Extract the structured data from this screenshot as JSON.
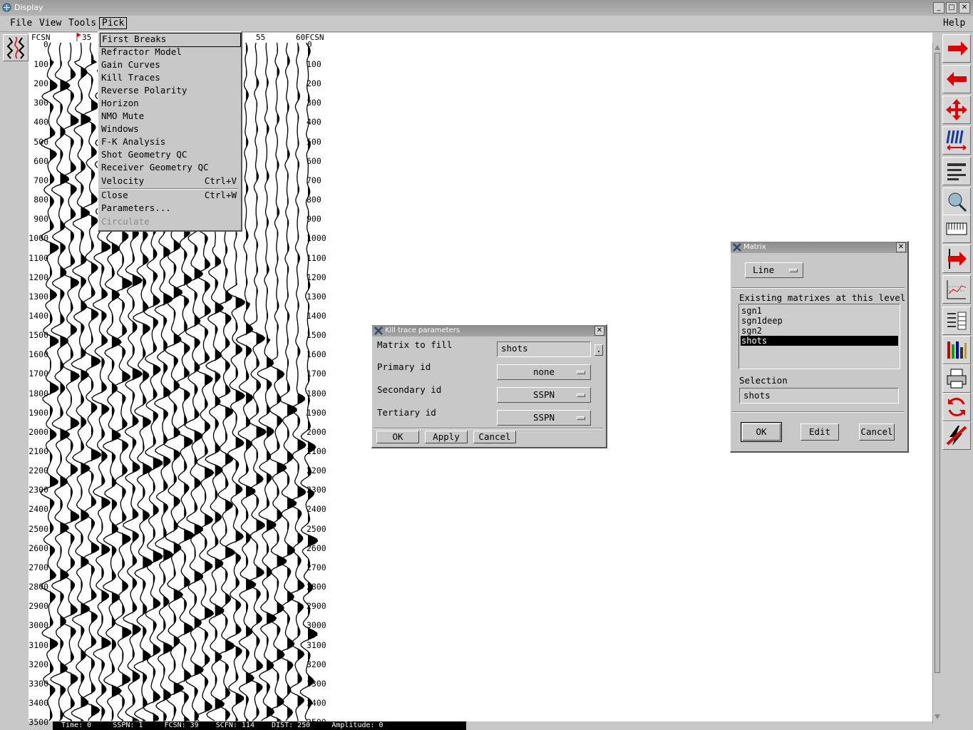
{
  "window": {
    "title": "Display",
    "controls": [
      "_",
      "□",
      "✕"
    ]
  },
  "menubar": {
    "items": [
      {
        "label": "File"
      },
      {
        "label": "View"
      },
      {
        "label": "Tools"
      },
      {
        "label": "Pick"
      }
    ],
    "help": "Help"
  },
  "pick_menu": {
    "items": [
      {
        "label": "First Breaks",
        "accel": ""
      },
      {
        "label": "Refractor Model",
        "accel": ""
      },
      {
        "label": "Gain Curves",
        "accel": ""
      },
      {
        "label": "Kill Traces",
        "accel": ""
      },
      {
        "label": "Reverse Polarity",
        "accel": ""
      },
      {
        "label": "Horizon",
        "accel": ""
      },
      {
        "label": "NMO Mute",
        "accel": ""
      },
      {
        "label": "Windows",
        "accel": ""
      },
      {
        "label": "F-K Analysis",
        "accel": ""
      },
      {
        "label": "Shot Geometry QC",
        "accel": ""
      },
      {
        "label": "Receiver Geometry QC",
        "accel": ""
      },
      {
        "label": "Velocity",
        "accel": "Ctrl+V"
      },
      {
        "label": "Close",
        "accel": "Ctrl+W"
      },
      {
        "label": "Parameters...",
        "accel": ""
      },
      {
        "label": "Circulate",
        "accel": "",
        "disabled": true
      }
    ]
  },
  "seismic": {
    "left_axis_title": "FCSN",
    "left_axis_zero": "0",
    "top_labels": [
      "35",
      "55",
      "60"
    ],
    "right_axis_title": "FCSN",
    "right_axis_zero": "0",
    "time_ticks": [
      "100",
      "200",
      "300",
      "400",
      "500",
      "600",
      "700",
      "800",
      "900",
      "1000",
      "1100",
      "1200",
      "1300",
      "1400",
      "1500",
      "1600",
      "1700",
      "1800",
      "1900",
      "2000",
      "2100",
      "2200",
      "2300",
      "2400",
      "2500",
      "2600",
      "2700",
      "2800",
      "2900",
      "3000",
      "3100",
      "3200",
      "3300",
      "3400",
      "3500"
    ],
    "right_ticks_partial": [
      "100",
      "200",
      "300",
      "400",
      "500",
      "600",
      "700",
      "800",
      "900"
    ]
  },
  "status": {
    "text": "  Time: 0     SSPN: 1     FCSN: 39    SCFN: 114    DIST: 250     Amplitude: 0"
  },
  "kill_dialog": {
    "title": "Kill trace parameters",
    "matrix_label": "Matrix to fill",
    "matrix_value": "shots",
    "browse": ".",
    "primary_label": "Primary id",
    "primary_value": "none",
    "secondary_label": "Secondary id",
    "secondary_value": "SSPN",
    "tertiary_label": "Tertiary id",
    "tertiary_value": "SSPN",
    "ok": "OK",
    "apply": "Apply",
    "cancel": "Cancel"
  },
  "matrix_dialog": {
    "title": "Matrix",
    "level_value": "Line",
    "existing_label": "Existing matrixes at this level",
    "items": [
      "sgn1",
      "sgn1deep",
      "sgn2",
      "shots"
    ],
    "selected_index": 3,
    "selection_label": "Selection",
    "selection_value": "shots",
    "ok": "OK",
    "edit": "Edit",
    "cancel": "Cancel"
  },
  "toolbar": {
    "icons": [
      "arrow-right-icon",
      "arrow-left-icon",
      "move-cross-icon",
      "trace-spacing-icon",
      "header-list-icon",
      "zoom-icon",
      "ruler-icon",
      "export-arrow-icon",
      "plot-options-icon",
      "layers-icon",
      "color-bars-icon",
      "print-icon",
      "refresh-icon",
      "no-power-icon"
    ],
    "accent": "#e00000"
  }
}
